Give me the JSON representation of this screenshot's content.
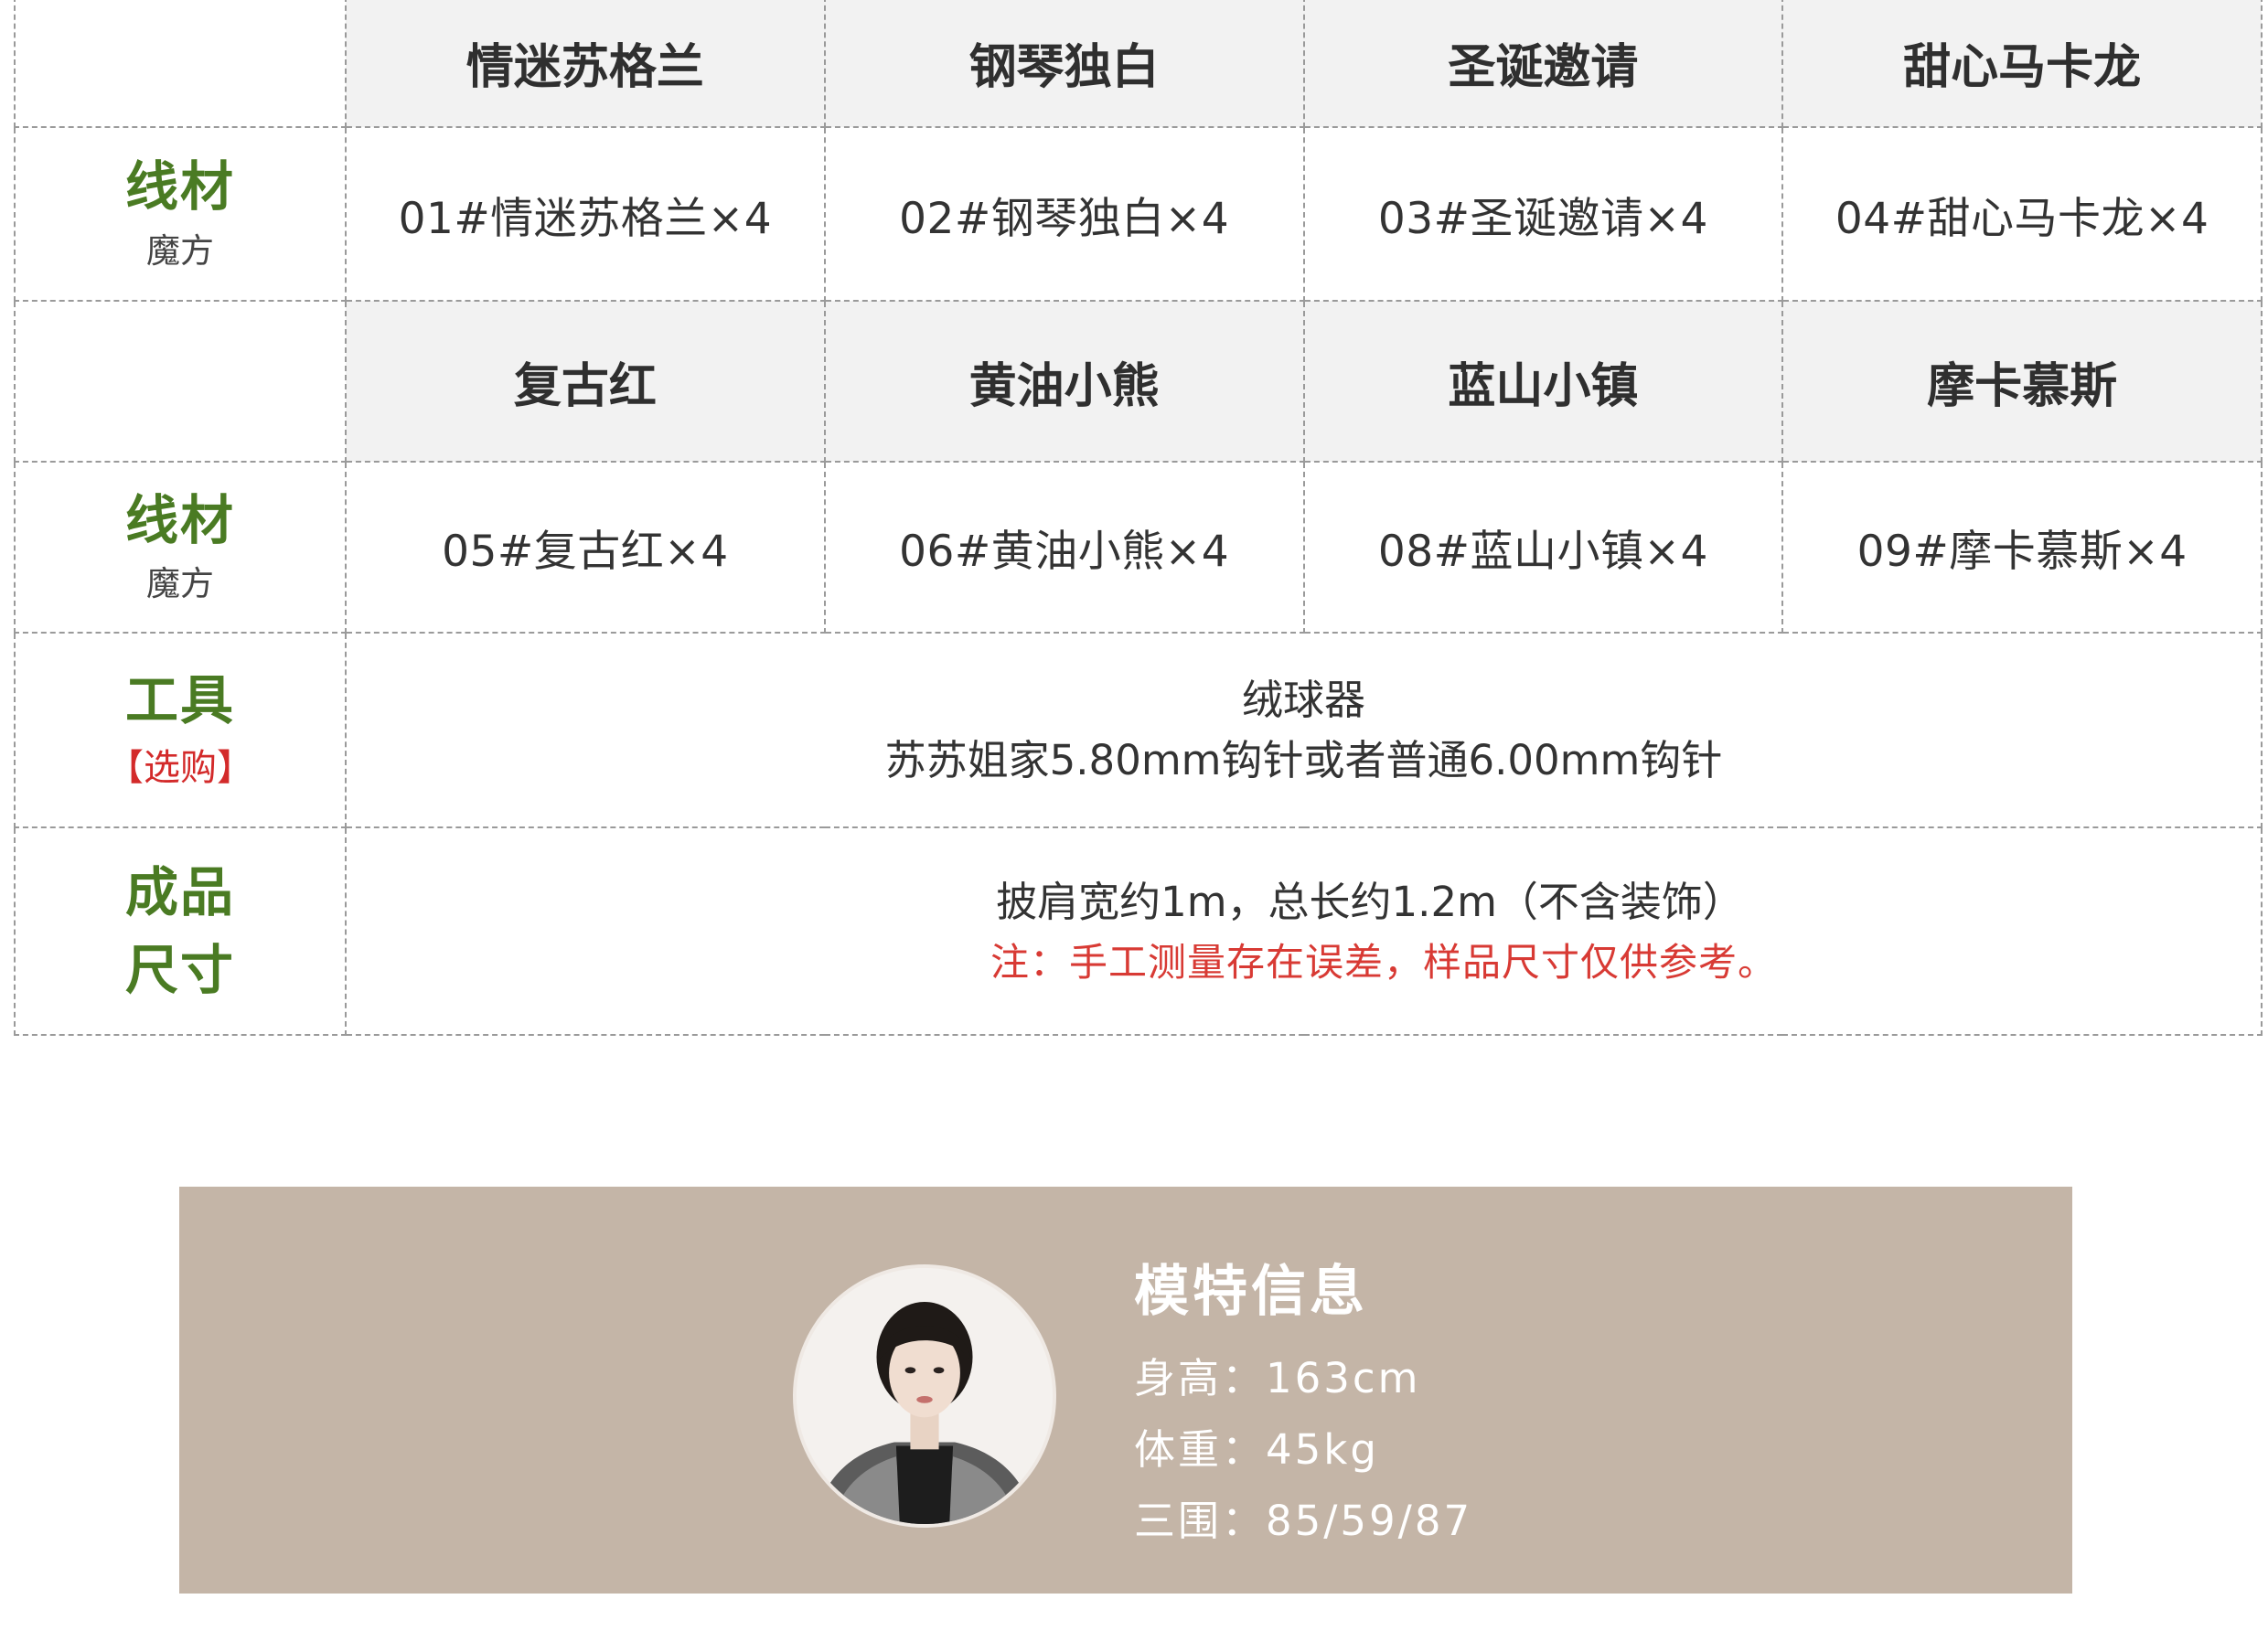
{
  "table": {
    "row1_headers": [
      "情迷苏格兰",
      "钢琴独白",
      "圣诞邀请",
      "甜心马卡龙"
    ],
    "row1_label": {
      "main": "线材",
      "sub": "魔方"
    },
    "row1_values": [
      "01#情迷苏格兰×4",
      "02#钢琴独白×4",
      "03#圣诞邀请×4",
      "04#甜心马卡龙×4"
    ],
    "row2_headers": [
      "复古红",
      "黄油小熊",
      "蓝山小镇",
      "摩卡慕斯"
    ],
    "row2_label": {
      "main": "线材",
      "sub": "魔方"
    },
    "row2_values": [
      "05#复古红×4",
      "06#黄油小熊×4",
      "08#蓝山小镇×4",
      "09#摩卡慕斯×4"
    ],
    "tools": {
      "label_main": "工具",
      "label_sub": "【选购】",
      "line1": "绒球器",
      "line2": "苏苏姐家5.80mm钩针或者普通6.00mm钩针"
    },
    "size": {
      "label_line1": "成品",
      "label_line2": "尺寸",
      "text": "披肩宽约1m，总长约1.2m（不含装饰）",
      "note": "注：手工测量存在误差，样品尺寸仅供参考。"
    }
  },
  "model": {
    "title": "模特信息",
    "height": "身高：163cm",
    "weight": "体重：45kg",
    "measurements": "三围：85/59/87",
    "card_color": "#c4b5a7"
  },
  "colors": {
    "label_green": "#4a7b23",
    "note_red": "#d32a2a",
    "header_gray": "#f2f2f2"
  }
}
